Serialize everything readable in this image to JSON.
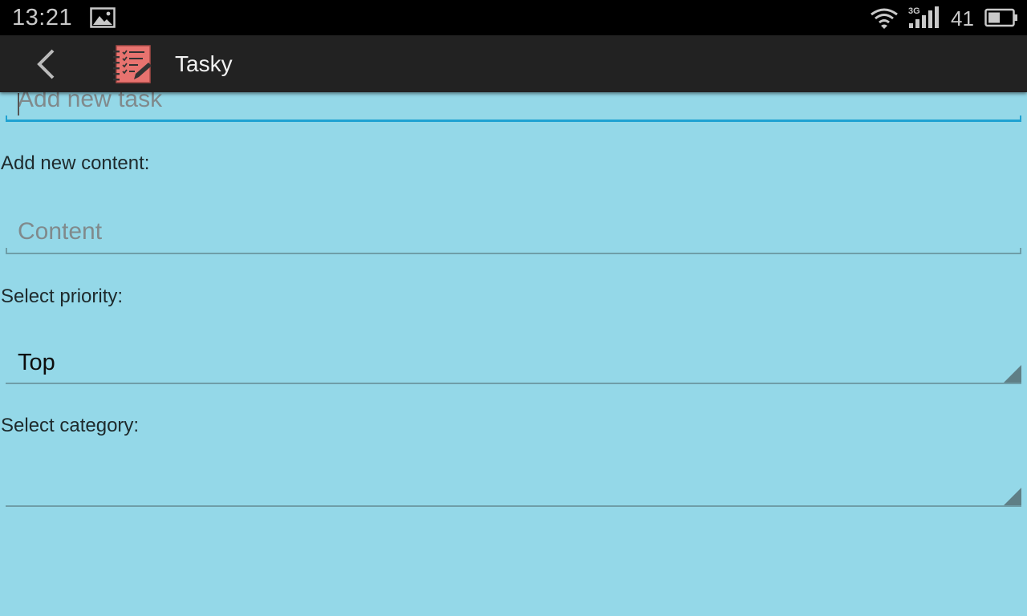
{
  "status_bar": {
    "time": "13:21",
    "battery_level": "41",
    "network_type": "3G",
    "icons": [
      "picture-icon",
      "wifi-icon",
      "signal-icon",
      "battery-icon"
    ]
  },
  "action_bar": {
    "title": "Tasky",
    "icons": [
      "back-arrow-icon",
      "app-logo-icon"
    ]
  },
  "form": {
    "task": {
      "placeholder": "Add new task",
      "value": ""
    },
    "content_label": "Add new content:",
    "content": {
      "placeholder": "Content",
      "value": ""
    },
    "priority_label": "Select priority:",
    "priority_selected": "Top",
    "category_label": "Select category:",
    "category_selected": ""
  },
  "colors": {
    "background": "#94d8e8",
    "action_bar": "#222222",
    "status_bar": "#000000",
    "focus_underline": "#1fa2d2",
    "logo": "#e8736f"
  }
}
